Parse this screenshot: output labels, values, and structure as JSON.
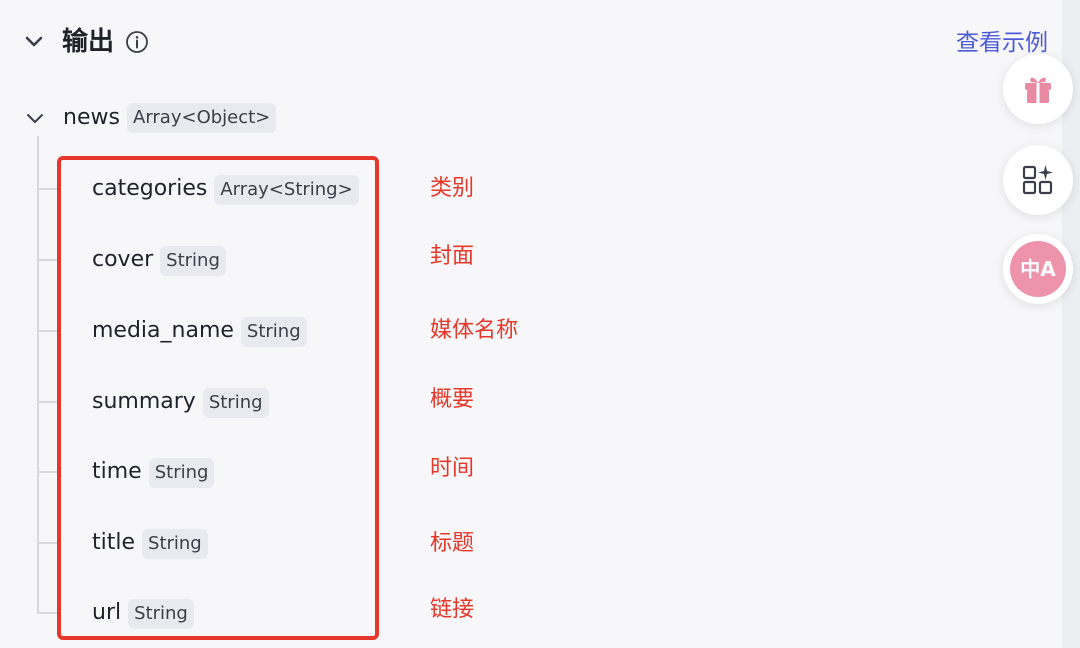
{
  "header": {
    "title": "输出",
    "link_label": "查看示例"
  },
  "tree": {
    "root": {
      "name": "news",
      "type": "Array<Object>"
    },
    "fields": [
      {
        "name": "categories",
        "type": "Array<String>",
        "note": "类别"
      },
      {
        "name": "cover",
        "type": "String",
        "note": "封面"
      },
      {
        "name": "media_name",
        "type": "String",
        "note": "媒体名称"
      },
      {
        "name": "summary",
        "type": "String",
        "note": "概要"
      },
      {
        "name": "time",
        "type": "String",
        "note": "时间"
      },
      {
        "name": "title",
        "type": "String",
        "note": "标题"
      },
      {
        "name": "url",
        "type": "String",
        "note": "链接"
      }
    ]
  },
  "floating_buttons": [
    {
      "icon": "gift-icon"
    },
    {
      "icon": "apps-sparkle-icon"
    },
    {
      "icon": "translate-icon",
      "glyph": "中A"
    }
  ],
  "colors": {
    "accent_link": "#4e5bd6",
    "annotation_red": "#e6382a",
    "tag_bg": "#e9eaef",
    "translate_pink": "#ee93ac",
    "gift_pink": "#e98aa3"
  }
}
